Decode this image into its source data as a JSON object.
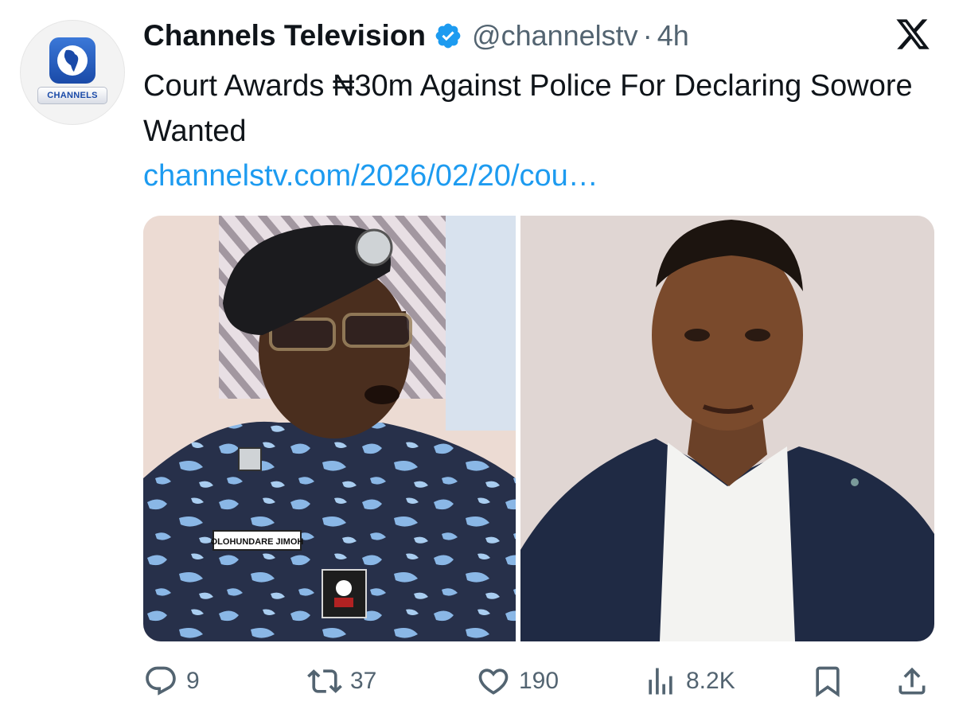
{
  "author": {
    "name": "Channels Television",
    "handle": "@channelstv",
    "separator": "·",
    "time": "4h",
    "logo_text": "CHANNELS",
    "verified_icon": "verified-badge-icon"
  },
  "tweet": {
    "text": "Court Awards ₦30m Against Police For Declaring Sowore Wanted",
    "link": "channelstv.com/2026/02/20/cou…"
  },
  "media": {
    "photos": [
      {
        "description_icon": "photo",
        "name_tag": "OLOHUNDARE JIMOH"
      },
      {
        "description_icon": "photo"
      }
    ]
  },
  "actions": {
    "replies": "9",
    "reposts": "37",
    "likes": "190",
    "views": "8.2K"
  },
  "colors": {
    "text": "#0f1419",
    "secondary": "#536471",
    "link": "#1d9bf0",
    "verified": "#1d9bf0"
  }
}
